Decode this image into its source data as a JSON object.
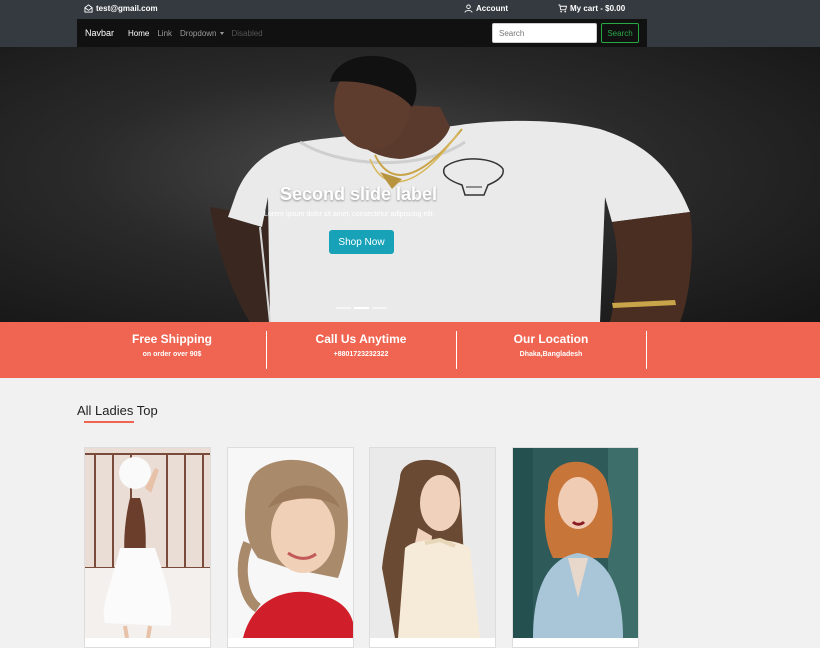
{
  "topbar": {
    "email": "test@gmail.com",
    "account": "Account",
    "cart": "My cart - $0.00"
  },
  "navbar": {
    "brand": "Navbar",
    "links": [
      "Home",
      "Link",
      "Dropdown",
      "Disabled"
    ],
    "search_placeholder": "Search",
    "search_button": "Search"
  },
  "hero": {
    "title": "Second slide label",
    "subtitle": "Lorem ipsum dolor sit amet, consectetur adipiscing elit.",
    "button": "Shop Now",
    "slides": 3,
    "active_slide": 2
  },
  "features": [
    {
      "title": "Free Shipping",
      "subtitle": "on order over 90$"
    },
    {
      "title": "Call Us Anytime",
      "subtitle": "+8801723232322"
    },
    {
      "title": "Our Location",
      "subtitle": "Dhaka,Bangladesh"
    }
  ],
  "section": {
    "title": "All Ladies Top"
  },
  "colors": {
    "accent": "#ef6551",
    "button_teal": "#17a2b8",
    "search_green": "#28a745",
    "dark": "#343a40"
  }
}
